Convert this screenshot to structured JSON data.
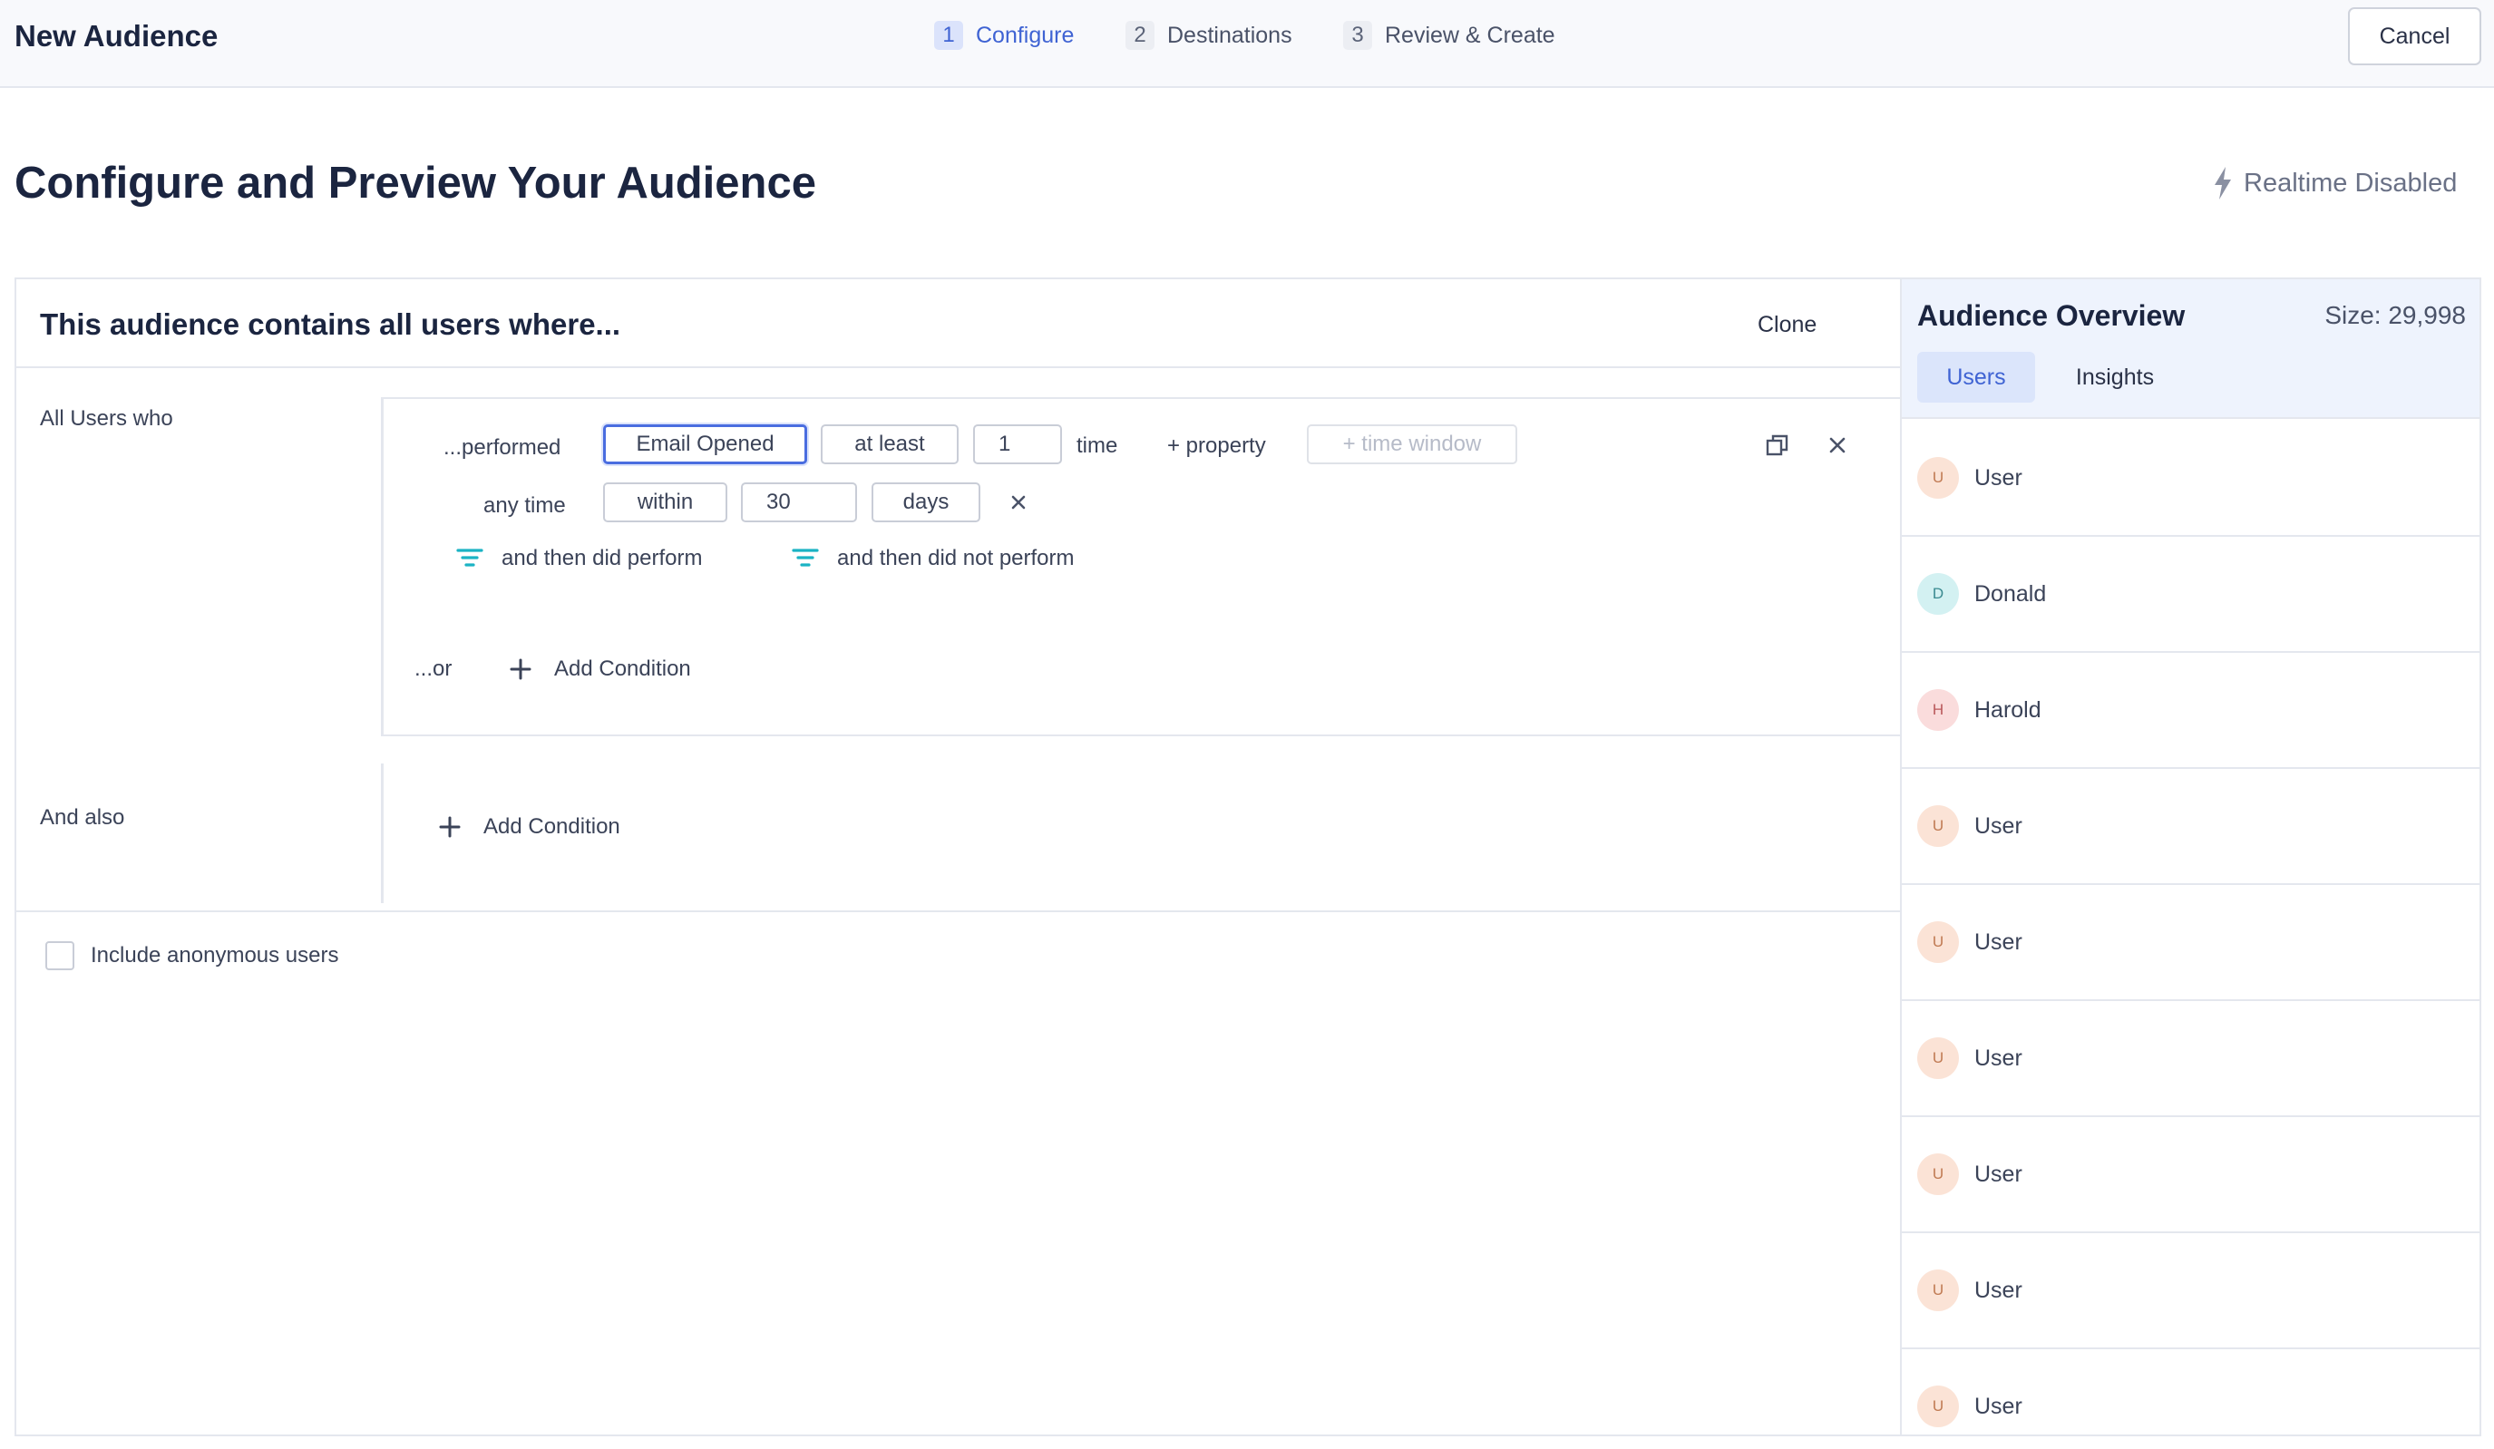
{
  "header": {
    "title": "New Audience",
    "steps": [
      {
        "num": "1",
        "label": "Configure",
        "active": true
      },
      {
        "num": "2",
        "label": "Destinations",
        "active": false
      },
      {
        "num": "3",
        "label": "Review & Create",
        "active": false
      }
    ],
    "cancel_label": "Cancel"
  },
  "page": {
    "title": "Configure and Preview Your Audience",
    "realtime_status": "Realtime Disabled"
  },
  "builder": {
    "heading": "This audience contains all users where...",
    "clone_label": "Clone",
    "group1": {
      "label": "All Users who",
      "condition": {
        "performed_label": "...performed",
        "event": "Email Opened",
        "operator": "at least",
        "count": "1",
        "count_unit": "time",
        "add_property": "+ property",
        "time_window_placeholder": "+ time window",
        "time_label": "any time",
        "time_operator": "within",
        "time_value": "30",
        "time_unit": "days",
        "then_did": "and then did perform",
        "then_did_not": "and then did not perform"
      },
      "or_label": "...or",
      "add_condition": "Add Condition"
    },
    "group2": {
      "label": "And also",
      "add_condition": "Add Condition"
    },
    "include_anonymous_label": "Include anonymous users"
  },
  "overview": {
    "title": "Audience Overview",
    "size": "Size: 29,998",
    "tabs": [
      "Users",
      "Insights"
    ],
    "users": [
      {
        "initial": "U",
        "name": "User",
        "color": "peach"
      },
      {
        "initial": "D",
        "name": "Donald",
        "color": "teal"
      },
      {
        "initial": "H",
        "name": "Harold",
        "color": "pink"
      },
      {
        "initial": "U",
        "name": "User",
        "color": "peach"
      },
      {
        "initial": "U",
        "name": "User",
        "color": "peach"
      },
      {
        "initial": "U",
        "name": "User",
        "color": "peach"
      },
      {
        "initial": "U",
        "name": "User",
        "color": "peach"
      },
      {
        "initial": "U",
        "name": "User",
        "color": "peach"
      },
      {
        "initial": "U",
        "name": "User",
        "color": "peach"
      }
    ]
  },
  "colors": {
    "accent": "#3f63d3",
    "filter_icon": "#1bb3c4",
    "border": "#e4e7ee"
  }
}
